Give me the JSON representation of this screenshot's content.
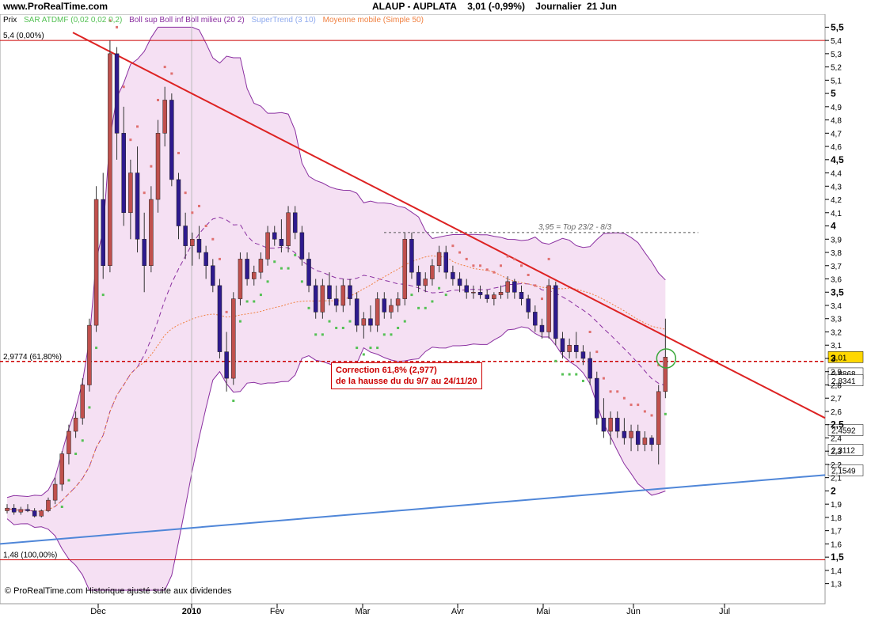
{
  "site": "www.ProRealTime.com",
  "header": {
    "symbol": "ALAUP",
    "name": "AUPLATA",
    "price": "3,01 (-0,99%)",
    "period": "Journalier",
    "date": "21 Jun"
  },
  "legend": {
    "prix": "Prix",
    "sar": "SAR ATDMF (0,02 0,02 0,2)",
    "boll": "Boll sup Boll inf Boll milieu (20 2)",
    "supertrend": "SuperTrend (3 10)",
    "ma": "Moyenne mobile (Simple 50)"
  },
  "colors": {
    "up_candle": "#c0504d",
    "down_candle": "#2e1a8e",
    "boll_fill": "#f1d6ef",
    "boll_line": "#8a2fa0",
    "sar": "#54c154",
    "sar_resist": "#e07070",
    "supertrend": "#8faaee",
    "ma50": "#f08040",
    "trendline_red": "#dd2222",
    "trendline_blue": "#4f86d8",
    "fib": "#cc0000"
  },
  "footer": "© ProRealTime.com  Historique ajusté suite aux dividendes",
  "chart_data": {
    "type": "candlestick",
    "y_ticks": [
      "5,5",
      "5,4",
      "5,3",
      "5,2",
      "5,1",
      "5",
      "4,9",
      "4,8",
      "4,7",
      "4,6",
      "4,5",
      "4,4",
      "4,3",
      "4,2",
      "4,1",
      "4",
      "3,9",
      "3,8",
      "3,7",
      "3,6",
      "3,5",
      "3,4",
      "3,3",
      "3,2",
      "3,1",
      "3",
      "2,9",
      "2,8",
      "2,7",
      "2,6",
      "2,5",
      "2,4",
      "2,3",
      "2,2",
      "2,1",
      "2",
      "1,9",
      "1,8",
      "1,7",
      "1,6",
      "1,5",
      "1,4",
      "1,3"
    ],
    "ylim": [
      1.25,
      5.55
    ],
    "x_labels": [
      "Dec",
      "2010",
      "Fev",
      "Mar",
      "Avr",
      "Mai",
      "Jun",
      "Jul"
    ],
    "hlines": [
      {
        "label": "5,4 (0,00%)",
        "value": 5.4
      },
      {
        "label": "2,9774 (61,80%)",
        "value": 2.9774
      },
      {
        "label": "1,48 (100,00%)",
        "value": 1.48
      }
    ],
    "top_line": {
      "label": "3,95 = Top 23/2 - 8/3",
      "value": 3.95
    },
    "annotation": {
      "line1": "Correction 61,8% (2,977)",
      "line2": "de la hausse du du 9/7 au 24/11/20"
    },
    "price_boxes": [
      {
        "label": "3,01",
        "value": 3.01
      },
      {
        "label": "2,8868",
        "value": 2.8868
      },
      {
        "label": "2,8341",
        "value": 2.8341
      },
      {
        "label": "2,4592",
        "value": 2.4592
      },
      {
        "label": "2,3112",
        "value": 2.3112
      },
      {
        "label": "2,1549",
        "value": 2.1549
      }
    ],
    "candles": [
      [
        1.85,
        1.9,
        1.83,
        1.87
      ],
      [
        1.87,
        1.9,
        1.82,
        1.84
      ],
      [
        1.84,
        1.88,
        1.82,
        1.86
      ],
      [
        1.86,
        1.9,
        1.84,
        1.85
      ],
      [
        1.85,
        1.87,
        1.8,
        1.81
      ],
      [
        1.81,
        1.86,
        1.8,
        1.85
      ],
      [
        1.85,
        1.95,
        1.84,
        1.93
      ],
      [
        1.93,
        2.1,
        1.9,
        2.05
      ],
      [
        2.05,
        2.3,
        2.0,
        2.28
      ],
      [
        2.28,
        2.5,
        2.2,
        2.45
      ],
      [
        2.45,
        2.6,
        2.4,
        2.55
      ],
      [
        2.55,
        2.85,
        2.5,
        2.8
      ],
      [
        2.8,
        3.3,
        2.75,
        3.25
      ],
      [
        3.25,
        4.3,
        3.2,
        4.2
      ],
      [
        4.2,
        4.4,
        3.6,
        3.7
      ],
      [
        3.7,
        5.4,
        3.65,
        5.3
      ],
      [
        5.3,
        5.35,
        4.5,
        4.7
      ],
      [
        4.7,
        4.9,
        4.0,
        4.1
      ],
      [
        4.1,
        4.5,
        3.9,
        4.4
      ],
      [
        4.4,
        4.6,
        3.8,
        3.9
      ],
      [
        3.9,
        4.1,
        3.5,
        3.7
      ],
      [
        3.7,
        4.3,
        3.65,
        4.2
      ],
      [
        4.2,
        4.8,
        4.1,
        4.7
      ],
      [
        4.7,
        5.05,
        4.6,
        4.95
      ],
      [
        4.95,
        5.0,
        4.3,
        4.35
      ],
      [
        4.35,
        4.4,
        3.9,
        4.0
      ],
      [
        4.0,
        4.1,
        3.75,
        3.85
      ],
      [
        3.85,
        3.95,
        3.7,
        3.9
      ],
      [
        3.9,
        4.0,
        3.75,
        3.8
      ],
      [
        3.8,
        3.85,
        3.6,
        3.7
      ],
      [
        3.7,
        3.75,
        3.5,
        3.55
      ],
      [
        3.55,
        3.6,
        3.0,
        3.05
      ],
      [
        3.05,
        3.2,
        2.75,
        2.85
      ],
      [
        2.85,
        3.5,
        2.8,
        3.45
      ],
      [
        3.45,
        3.8,
        3.4,
        3.75
      ],
      [
        3.75,
        3.8,
        3.55,
        3.6
      ],
      [
        3.6,
        3.7,
        3.55,
        3.65
      ],
      [
        3.65,
        3.8,
        3.6,
        3.75
      ],
      [
        3.75,
        4.0,
        3.7,
        3.95
      ],
      [
        3.95,
        4.0,
        3.85,
        3.9
      ],
      [
        3.9,
        4.05,
        3.8,
        3.85
      ],
      [
        3.85,
        4.15,
        3.8,
        4.1
      ],
      [
        4.1,
        4.15,
        3.9,
        3.95
      ],
      [
        3.95,
        4.0,
        3.7,
        3.75
      ],
      [
        3.75,
        3.8,
        3.5,
        3.55
      ],
      [
        3.55,
        3.6,
        3.3,
        3.35
      ],
      [
        3.35,
        3.6,
        3.3,
        3.55
      ],
      [
        3.55,
        3.65,
        3.4,
        3.45
      ],
      [
        3.45,
        3.55,
        3.35,
        3.4
      ],
      [
        3.4,
        3.6,
        3.35,
        3.55
      ],
      [
        3.55,
        3.6,
        3.4,
        3.45
      ],
      [
        3.45,
        3.5,
        3.2,
        3.25
      ],
      [
        3.25,
        3.35,
        3.15,
        3.3
      ],
      [
        3.3,
        3.4,
        3.2,
        3.25
      ],
      [
        3.25,
        3.5,
        3.2,
        3.45
      ],
      [
        3.45,
        3.5,
        3.3,
        3.35
      ],
      [
        3.35,
        3.45,
        3.3,
        3.4
      ],
      [
        3.4,
        3.5,
        3.35,
        3.45
      ],
      [
        3.45,
        3.95,
        3.4,
        3.9
      ],
      [
        3.9,
        3.95,
        3.6,
        3.65
      ],
      [
        3.65,
        3.7,
        3.5,
        3.55
      ],
      [
        3.55,
        3.65,
        3.5,
        3.6
      ],
      [
        3.6,
        3.75,
        3.55,
        3.7
      ],
      [
        3.7,
        3.85,
        3.65,
        3.8
      ],
      [
        3.8,
        3.85,
        3.6,
        3.65
      ],
      [
        3.65,
        3.7,
        3.55,
        3.6
      ],
      [
        3.6,
        3.65,
        3.5,
        3.55
      ],
      [
        3.55,
        3.6,
        3.45,
        3.5
      ],
      [
        3.5,
        3.55,
        3.45,
        3.5
      ],
      [
        3.5,
        3.55,
        3.45,
        3.48
      ],
      [
        3.48,
        3.52,
        3.42,
        3.45
      ],
      [
        3.45,
        3.5,
        3.4,
        3.48
      ],
      [
        3.48,
        3.55,
        3.45,
        3.5
      ],
      [
        3.5,
        3.62,
        3.45,
        3.58
      ],
      [
        3.58,
        3.6,
        3.45,
        3.5
      ],
      [
        3.5,
        3.55,
        3.4,
        3.45
      ],
      [
        3.45,
        3.48,
        3.3,
        3.35
      ],
      [
        3.35,
        3.4,
        3.2,
        3.25
      ],
      [
        3.25,
        3.3,
        3.15,
        3.2
      ],
      [
        3.2,
        3.6,
        3.15,
        3.55
      ],
      [
        3.55,
        3.58,
        3.1,
        3.15
      ],
      [
        3.15,
        3.2,
        3.0,
        3.05
      ],
      [
        3.05,
        3.15,
        3.0,
        3.1
      ],
      [
        3.1,
        3.2,
        3.0,
        3.05
      ],
      [
        3.05,
        3.1,
        2.95,
        3.0
      ],
      [
        3.0,
        3.05,
        2.8,
        2.85
      ],
      [
        2.85,
        2.9,
        2.5,
        2.55
      ],
      [
        2.55,
        2.7,
        2.4,
        2.45
      ],
      [
        2.45,
        2.6,
        2.35,
        2.55
      ],
      [
        2.55,
        2.6,
        2.4,
        2.45
      ],
      [
        2.45,
        2.55,
        2.35,
        2.4
      ],
      [
        2.4,
        2.5,
        2.3,
        2.45
      ],
      [
        2.45,
        2.5,
        2.3,
        2.35
      ],
      [
        2.35,
        2.45,
        2.3,
        2.4
      ],
      [
        2.4,
        2.42,
        2.3,
        2.35
      ],
      [
        2.35,
        2.8,
        2.2,
        2.75
      ],
      [
        2.75,
        3.3,
        2.7,
        3.01
      ]
    ]
  }
}
